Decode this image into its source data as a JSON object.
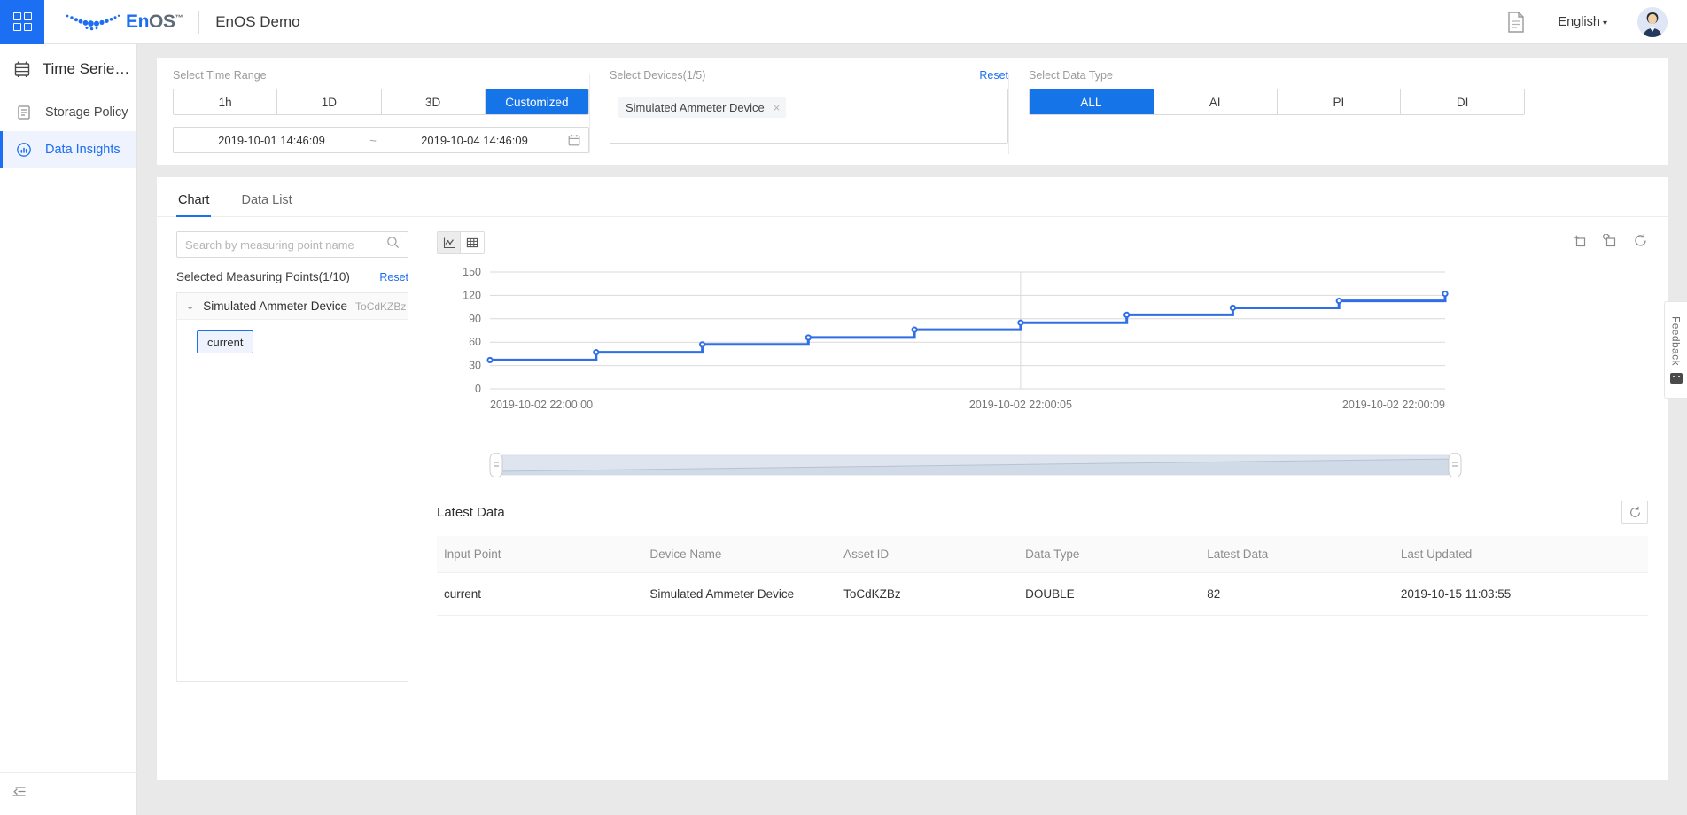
{
  "header": {
    "grid_icon": "apps-grid-icon",
    "logo_en": "En",
    "logo_os": "OS",
    "logo_tm": "™",
    "app_title": "EnOS Demo",
    "doc_icon": "document-icon",
    "language": "English",
    "lang_caret": "▾",
    "avatar_icon": "user-avatar"
  },
  "sidebar": {
    "items": [
      {
        "label": "Time Series D...",
        "icon": "database-icon",
        "active": false
      },
      {
        "label": "Storage Policy",
        "icon": "storage-icon",
        "active": false
      },
      {
        "label": "Data Insights",
        "icon": "insights-icon",
        "active": true
      }
    ],
    "collapse_icon": "collapse-sidebar-icon"
  },
  "filters": {
    "time_range": {
      "label": "Select Time Range",
      "options": [
        "1h",
        "1D",
        "3D",
        "Customized"
      ],
      "selected": "Customized",
      "start": "2019-10-01 14:46:09",
      "separator": "~",
      "end": "2019-10-04 14:46:09",
      "calendar_icon": "calendar-icon"
    },
    "devices": {
      "label": "Select Devices(1/5)",
      "reset": "Reset",
      "tags": [
        "Simulated Ammeter Device"
      ],
      "remove_icon": "×"
    },
    "data_type": {
      "label": "Select Data Type",
      "options": [
        "ALL",
        "AI",
        "PI",
        "DI"
      ],
      "selected": "ALL"
    }
  },
  "main": {
    "tabs": [
      {
        "label": "Chart",
        "active": true
      },
      {
        "label": "Data List",
        "active": false
      }
    ],
    "points": {
      "search_placeholder": "Search by measuring point name",
      "search_value": "",
      "search_icon": "search-icon",
      "selected_label": "Selected Measuring Points(1/10)",
      "reset": "Reset",
      "device_group": {
        "chevron": "⌄",
        "name": "Simulated Ammeter Device",
        "asset_id": "ToCdKZBz",
        "points": [
          "current"
        ]
      }
    },
    "chart_toolbar": {
      "line_icon": "line-chart-icon",
      "table_icon": "data-table-icon",
      "zoom_in_icon": "zoom-select-icon",
      "zoom_back_icon": "zoom-restore-icon",
      "refresh_icon": "refresh-icon"
    },
    "latest": {
      "title": "Latest Data",
      "refresh_icon": "refresh-icon",
      "columns": [
        "Input Point",
        "Device Name",
        "Asset ID",
        "Data Type",
        "Latest Data",
        "Last Updated"
      ],
      "rows": [
        [
          "current",
          "Simulated Ammeter Device",
          "ToCdKZBz",
          "DOUBLE",
          "82",
          "2019-10-15 11:03:55"
        ]
      ]
    }
  },
  "feedback": {
    "label": "Feedback",
    "icon": "smiley-icon"
  },
  "colors": {
    "accent": "#1c6ef2",
    "series": "#2f6ee8",
    "panel": "#ffffff",
    "page_bg": "#e9e9e9"
  },
  "chart_data": {
    "type": "line",
    "title": "",
    "xlabel": "",
    "ylabel": "",
    "ylim": [
      0,
      150
    ],
    "yticks": [
      0,
      30,
      60,
      90,
      120,
      150
    ],
    "grid": true,
    "legend": false,
    "step": "post",
    "xtick_labels": [
      "2019-10-02 22:00:00",
      "2019-10-02 22:00:05",
      "2019-10-02 22:00:09"
    ],
    "xtick_positions": [
      0,
      5,
      9
    ],
    "xlim": [
      0,
      9
    ],
    "series": [
      {
        "name": "current",
        "color": "#2f6ee8",
        "x": [
          0,
          1,
          2,
          3,
          4,
          5,
          6,
          7,
          8,
          9
        ],
        "values": [
          37,
          47,
          57,
          66,
          76,
          85,
          95,
          104,
          113,
          122
        ]
      }
    ]
  }
}
